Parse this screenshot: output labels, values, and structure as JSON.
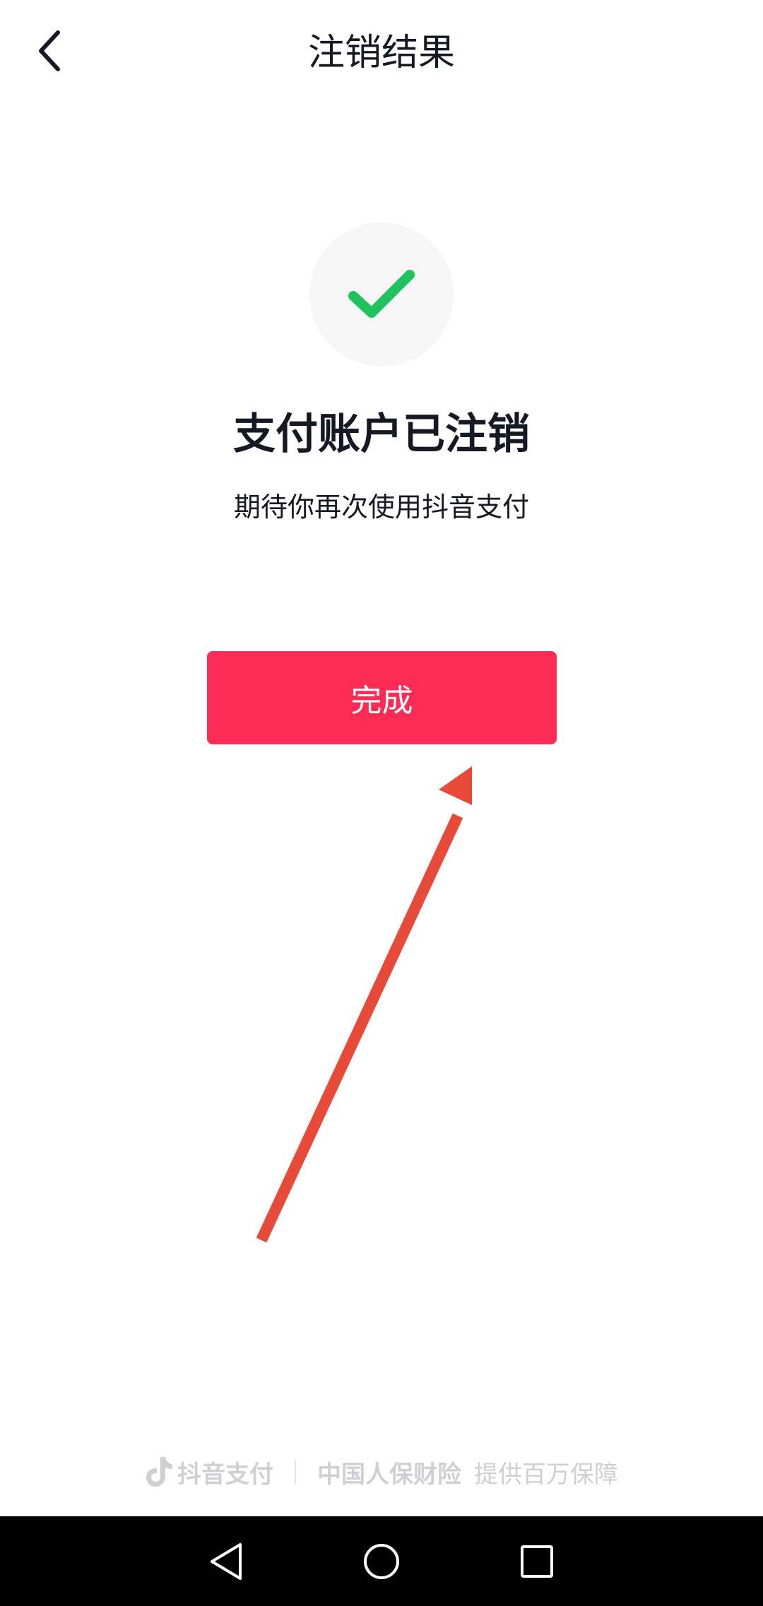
{
  "header": {
    "title": "注销结果"
  },
  "result": {
    "title": "支付账户已注销",
    "subtitle": "期待你再次使用抖音支付"
  },
  "actions": {
    "done_label": "完成"
  },
  "footer": {
    "brand": "抖音支付",
    "insurer": "中国人保财险",
    "guarantee": "提供百万保障"
  },
  "colors": {
    "accent": "#fe2c55",
    "success": "#1fc25d",
    "annotation_arrow": "#e84a3a"
  },
  "icons": {
    "back": "chevron-left-icon",
    "success": "checkmark-icon",
    "brand": "tiktok-note-icon",
    "nav_back": "triangle-back-icon",
    "nav_home": "circle-home-icon",
    "nav_recents": "square-recents-icon"
  }
}
